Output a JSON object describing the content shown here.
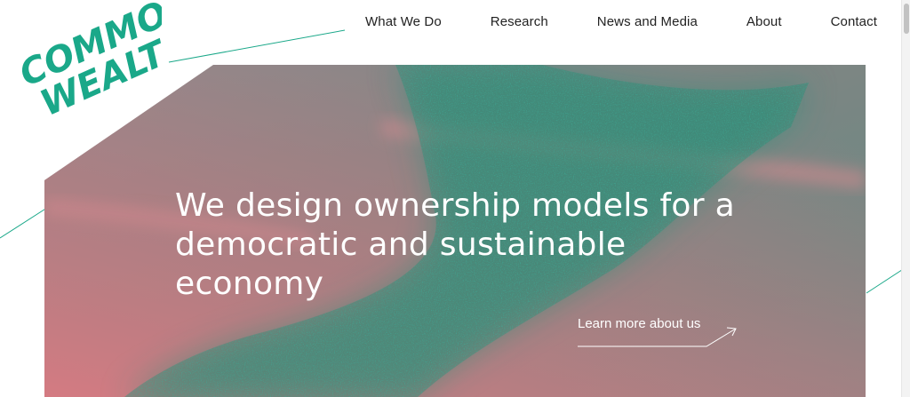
{
  "brand": {
    "logo_line1": "COMMON",
    "logo_line2": "WEALTH",
    "accent_color": "#1aa889"
  },
  "nav": {
    "items": [
      {
        "label": "What We Do"
      },
      {
        "label": "Research"
      },
      {
        "label": "News and Media"
      },
      {
        "label": "About"
      },
      {
        "label": "Contact"
      }
    ]
  },
  "hero": {
    "headline": "We design ownership models for a democratic and sustainable economy",
    "cta_label": "Learn more about us",
    "cta_icon": "arrow-up-right-icon"
  }
}
